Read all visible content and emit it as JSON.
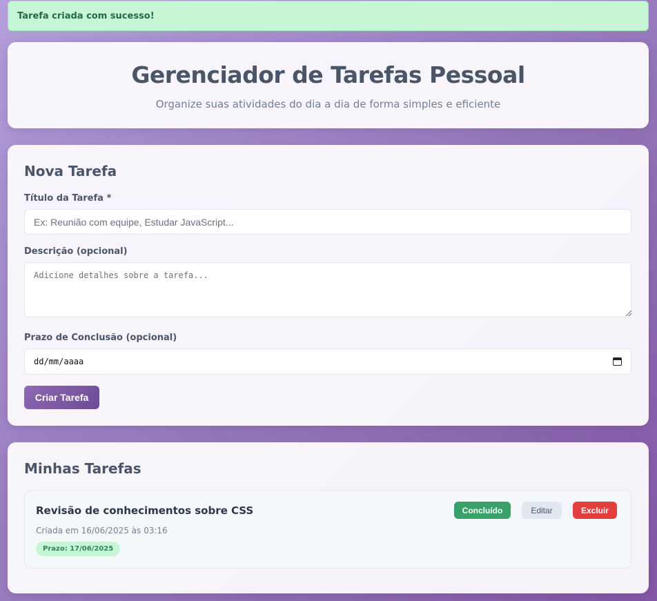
{
  "toast": {
    "message": "Tarefa criada com sucesso!"
  },
  "header": {
    "title": "Gerenciador de Tarefas Pessoal",
    "subtitle": "Organize suas atividades do dia a dia de forma simples e eficiente"
  },
  "form": {
    "section_title": "Nova Tarefa",
    "title_label": "Título da Tarefa *",
    "title_placeholder": "Ex: Reunião com equipe, Estudar JavaScript...",
    "title_value": "",
    "description_label": "Descrição (opcional)",
    "description_placeholder": "Adicione detalhes sobre a tarefa...",
    "description_value": "",
    "deadline_label": "Prazo de Conclusão (opcional)",
    "deadline_placeholder": "dd/mm/aaaa",
    "submit_label": "Criar Tarefa"
  },
  "tasks": {
    "section_title": "Minhas Tarefas",
    "items": [
      {
        "title": "Revisão de conhecimentos sobre CSS",
        "created": "Criada em 16/06/2025 às 03:16",
        "deadline": "Prazo: 17/06/2025",
        "done_label": "Concluído",
        "edit_label": "Editar",
        "delete_label": "Excluir"
      }
    ]
  },
  "colors": {
    "success": "#38a169",
    "danger": "#e53e3e",
    "primary": "#7e57a5",
    "text": "#4a5568"
  },
  "icons": {
    "deadline_picker": "calendar-icon"
  }
}
